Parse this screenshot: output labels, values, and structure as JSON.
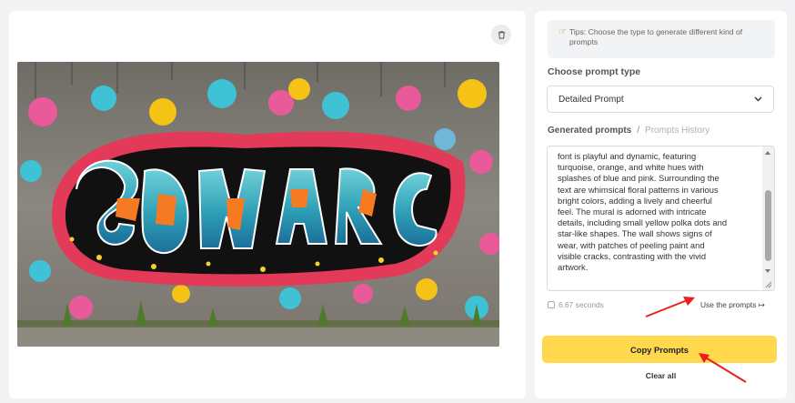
{
  "tips": {
    "icon": "pointing-hand-icon",
    "text": "Tips: Choose the type to generate different kind of prompts"
  },
  "prompt_type": {
    "label": "Choose prompt type",
    "selected": "Detailed Prompt"
  },
  "prompts": {
    "generated_tab": "Generated prompts",
    "separator": "/",
    "history_tab": "Prompts History",
    "text": "font is playful and dynamic, featuring\nturquoise, orange, and white hues with\nsplashes of blue and pink. Surrounding the\ntext are whimsical floral patterns in various\nbright colors, adding a lively and cheerful\nfeel. The mural is adorned with intricate\ndetails, including small yellow polka dots and\nstar-like shapes. The wall shows signs of\nwear, with patches of peeling paint and\nvisible cracks, contrasting with the vivid\nartwork.",
    "time": "6.67 seconds",
    "use_label": "Use the prompts ↦"
  },
  "actions": {
    "copy": "Copy Prompts",
    "clear": "Clear all"
  },
  "colors": {
    "accent": "#ffd84d",
    "annotation_arrow": "#e8201e"
  }
}
